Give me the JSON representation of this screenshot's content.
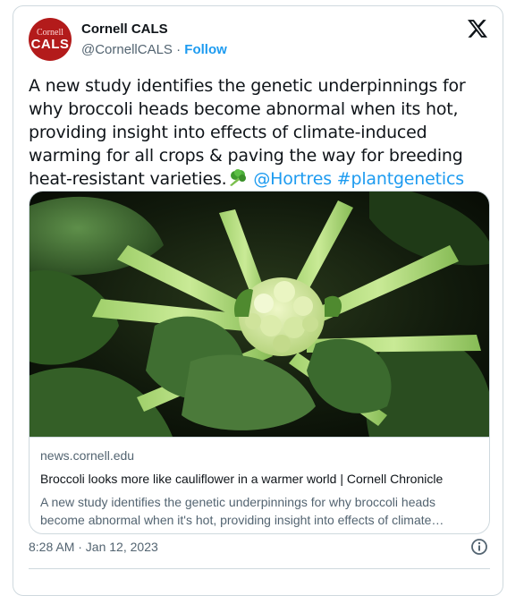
{
  "author": {
    "avatar_text_top": "Cornell",
    "avatar_text_bottom": "CALS",
    "name": "Cornell CALS",
    "handle": "@CornellCALS",
    "separator": " · ",
    "follow_label": "Follow"
  },
  "tweet": {
    "text": "A new study identifies the genetic underpinnings for why broccoli heads become abnormal when its hot, providing insight into effects of climate-induced warming for all crops & paving the way for breeding heat-resistant varieties.",
    "mention": "@Hortres",
    "hashtag": "#plantgenetics",
    "emoji": "broccoli-emoji"
  },
  "link_card": {
    "domain": "news.cornell.edu",
    "title": "Broccoli looks more like cauliflower in a warmer world | Cornell Chronicle",
    "description": "A new study identifies the genetic underpinnings for why broccoli heads become abnormal when it's hot, providing insight into effects of climate…"
  },
  "timestamp": "8:28 AM · Jan 12, 2023",
  "icons": {
    "platform": "x-logo-icon",
    "info": "info-icon"
  },
  "colors": {
    "link": "#1d9bf0",
    "secondary_text": "#536471",
    "primary_text": "#0f1419",
    "brand_red": "#b31b1b",
    "border": "#cfd9de"
  }
}
